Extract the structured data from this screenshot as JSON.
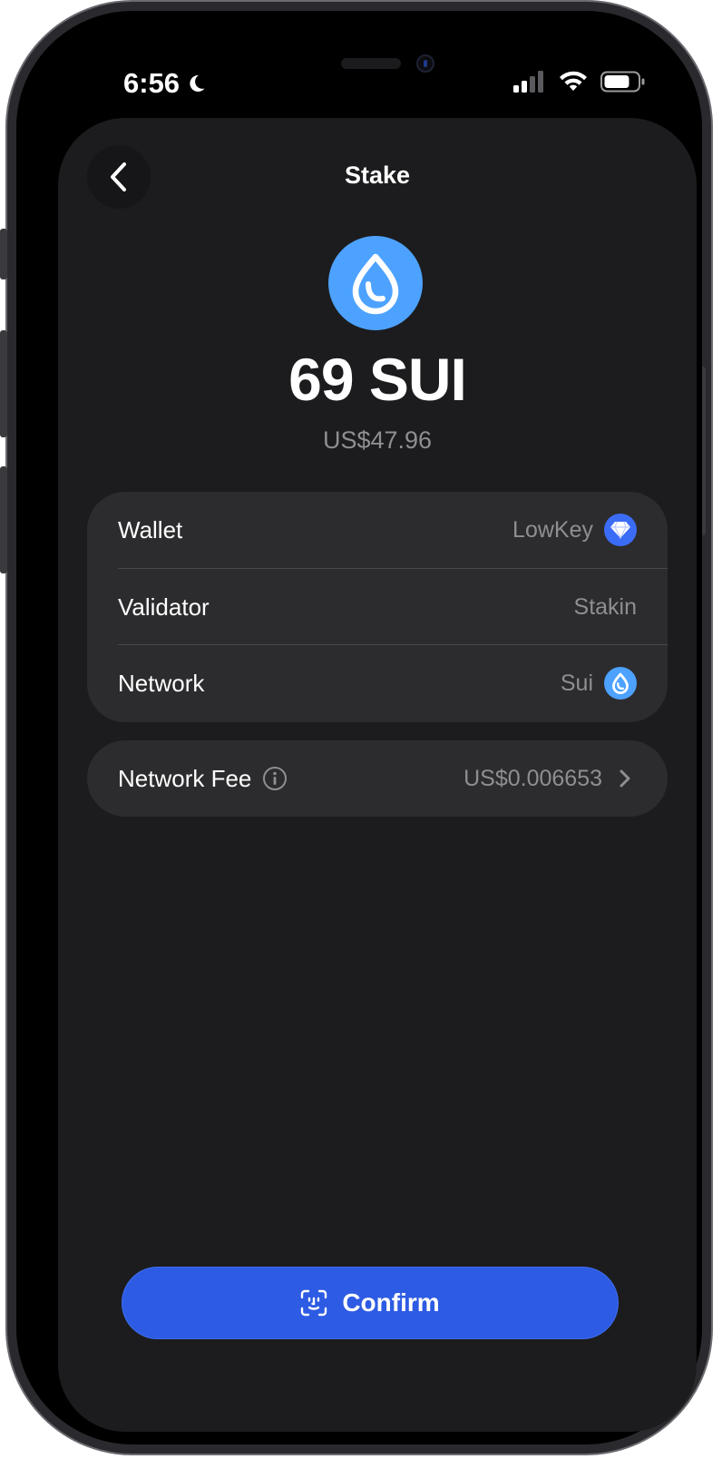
{
  "status": {
    "time": "6:56"
  },
  "header": {
    "title": "Stake"
  },
  "token": {
    "amount": "69 SUI",
    "fiat_value": "US$47.96"
  },
  "details": {
    "wallet_label": "Wallet",
    "wallet_value": "LowKey",
    "validator_label": "Validator",
    "validator_value": "Stakin",
    "network_label": "Network",
    "network_value": "Sui"
  },
  "fee": {
    "label": "Network Fee",
    "value": "US$0.006653"
  },
  "actions": {
    "confirm_label": "Confirm"
  },
  "colors": {
    "background": "#1c1c1e",
    "card": "#2c2c2e",
    "accent": "#2d5be3",
    "sui_blue": "#4da2ff",
    "wallet_icon_blue": "#3b6cf6"
  },
  "icons": {
    "back": "chevron-left-icon",
    "token": "sui-drop-icon",
    "wallet": "diamond-icon",
    "info": "info-icon",
    "chevron": "chevron-right-icon",
    "confirm": "face-id-icon"
  }
}
